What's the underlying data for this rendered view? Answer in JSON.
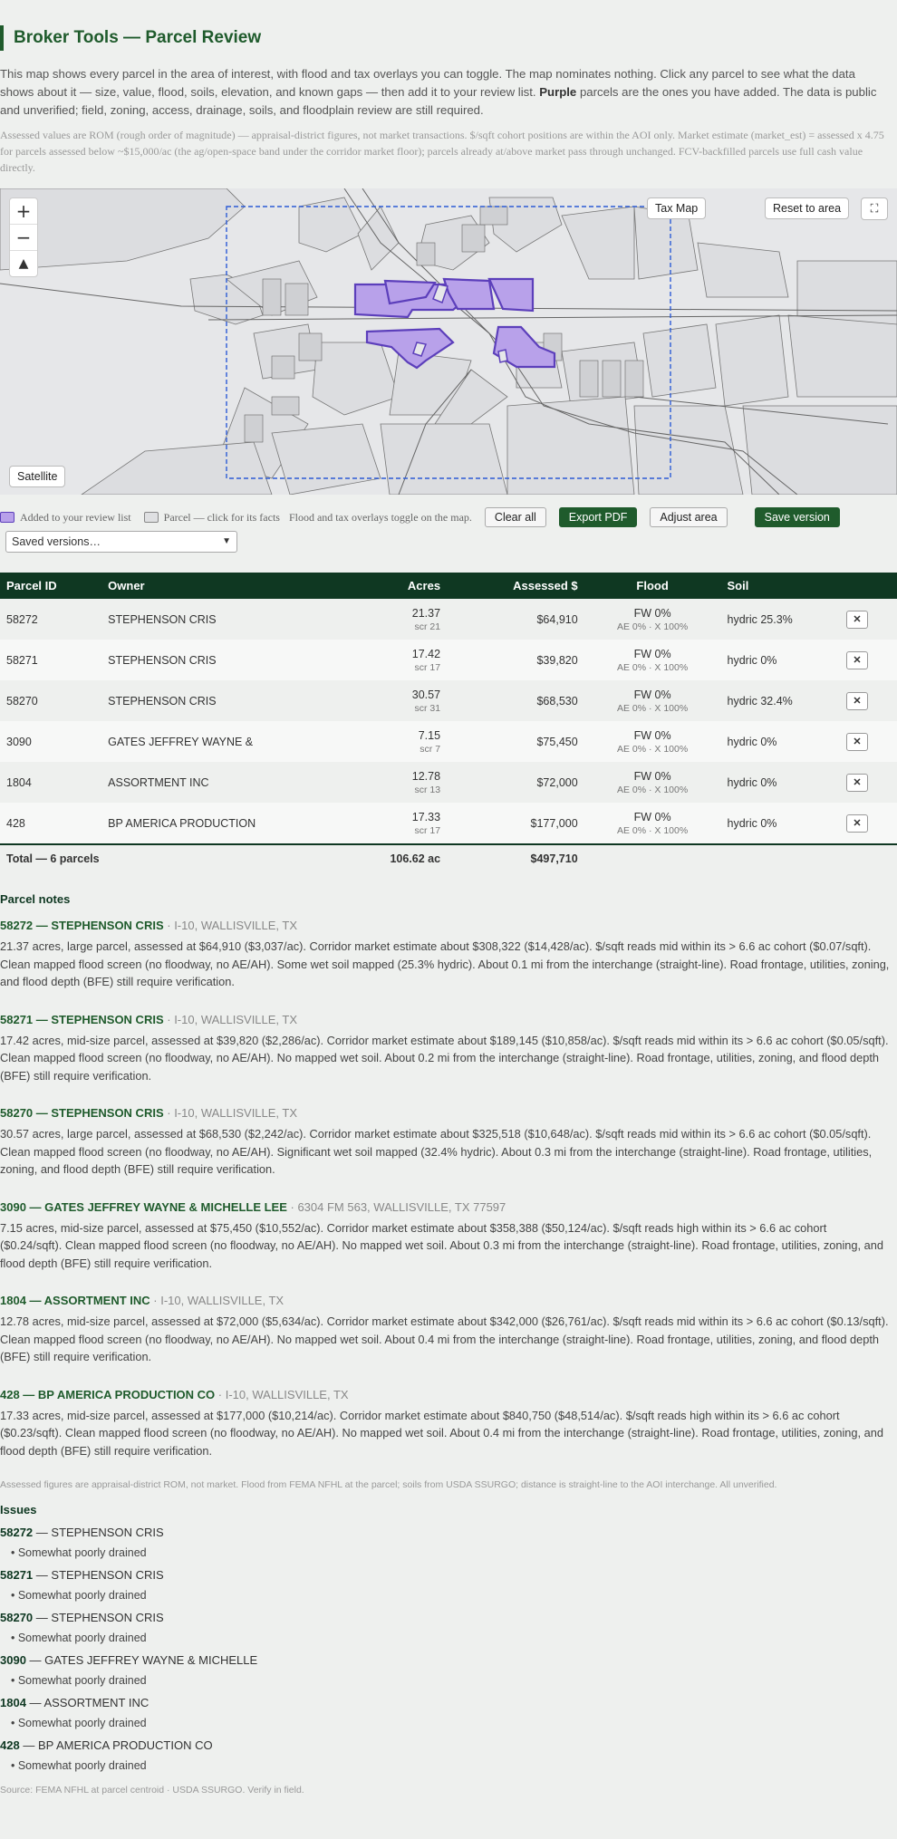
{
  "app": {
    "title": "Broker Tools — Parcel Review",
    "intro_main": "This map shows every parcel in the area of interest, with flood and tax overlays you can toggle. The map nominates nothing. Click any parcel to see what the data shows about it — size, value, flood, soils, elevation, and known gaps — then add it to your review list.",
    "intro_bold": "Purple",
    "intro_tail": "parcels are the ones you have added. The data is public and unverified; field, zoning, access, drainage, soils, and floodplain review are still required.",
    "fine_print": "Assessed values are ROM (rough order of magnitude) — appraisal-district figures, not market transactions. $/sqft cohort positions are within the AOI only. Market estimate (market_est) = assessed x 4.75 for parcels assessed below ~$15,000/ac (the ag/open-space band under the corridor market floor); parcels already at/above market pass through unchanged. FCV-backfilled parcels use full cash value directly."
  },
  "map": {
    "tax_map_label": "Tax Map",
    "reset_label": "Reset to area",
    "fullscreen_icon": "fullscreen-icon",
    "satellite_label": "Satellite",
    "zoom_in": "+",
    "zoom_out": "−",
    "north": "▲"
  },
  "legend": {
    "review_label": "Added to your review list",
    "parcel_label": "Parcel — click for its facts",
    "overlay_label": "Flood and tax overlays toggle on the map.",
    "colors": {
      "review": "#b8a1ea",
      "review_border": "#5c3fbb",
      "parcel": "#dfe0e2"
    }
  },
  "toolbar": {
    "clear_label": "Clear all",
    "export_label": "Export PDF",
    "adjust_label": "Adjust area",
    "save_label": "Save version",
    "versions_selected": "Saved versions…"
  },
  "table": {
    "headers": [
      "Parcel ID",
      "Owner",
      "Acres",
      "Assessed $",
      "Flood",
      "Soil",
      ""
    ],
    "rows": [
      {
        "id": "58272",
        "owner": "STEPHENSON CRIS",
        "acres": "21.37",
        "scr": "scr 21",
        "assessed": "$64,910",
        "flood": "FW 0%",
        "flood_sub": "AE 0% · X 100%",
        "soil": "hydric 25.3%"
      },
      {
        "id": "58271",
        "owner": "STEPHENSON CRIS",
        "acres": "17.42",
        "scr": "scr 17",
        "assessed": "$39,820",
        "flood": "FW 0%",
        "flood_sub": "AE 0% · X 100%",
        "soil": "hydric 0%"
      },
      {
        "id": "58270",
        "owner": "STEPHENSON CRIS",
        "acres": "30.57",
        "scr": "scr 31",
        "assessed": "$68,530",
        "flood": "FW 0%",
        "flood_sub": "AE 0% · X 100%",
        "soil": "hydric 32.4%"
      },
      {
        "id": "3090",
        "owner": "GATES JEFFREY WAYNE &",
        "acres": "7.15",
        "scr": "scr 7",
        "assessed": "$75,450",
        "flood": "FW 0%",
        "flood_sub": "AE 0% · X 100%",
        "soil": "hydric 0%"
      },
      {
        "id": "1804",
        "owner": "ASSORTMENT INC",
        "acres": "12.78",
        "scr": "scr 13",
        "assessed": "$72,000",
        "flood": "FW 0%",
        "flood_sub": "AE 0% · X 100%",
        "soil": "hydric 0%"
      },
      {
        "id": "428",
        "owner": "BP AMERICA PRODUCTION",
        "acres": "17.33",
        "scr": "scr 17",
        "assessed": "$177,000",
        "flood": "FW 0%",
        "flood_sub": "AE 0% · X 100%",
        "soil": "hydric 0%"
      }
    ],
    "remove_label": "✕",
    "total_label": "Total — 6 parcels",
    "total_acres": "106.62 ac",
    "total_assessed": "$497,710"
  },
  "notes": {
    "title": "Parcel notes",
    "items": [
      {
        "head": "58272 — STEPHENSON CRIS",
        "loc": "· I-10, WALLISVILLE, TX",
        "body": "21.37 acres, large parcel, assessed at $64,910 ($3,037/ac). Corridor market estimate about $308,322 ($14,428/ac). $/sqft reads mid within its > 6.6 ac cohort ($0.07/sqft). Clean mapped flood screen (no floodway, no AE/AH). Some wet soil mapped (25.3% hydric). About 0.1 mi from the interchange (straight-line). Road frontage, utilities, zoning, and flood depth (BFE) still require verification."
      },
      {
        "head": "58271 — STEPHENSON CRIS",
        "loc": "· I-10, WALLISVILLE, TX",
        "body": "17.42 acres, mid-size parcel, assessed at $39,820 ($2,286/ac). Corridor market estimate about $189,145 ($10,858/ac). $/sqft reads mid within its > 6.6 ac cohort ($0.05/sqft). Clean mapped flood screen (no floodway, no AE/AH). No mapped wet soil. About 0.2 mi from the interchange (straight-line). Road frontage, utilities, zoning, and flood depth (BFE) still require verification."
      },
      {
        "head": "58270 — STEPHENSON CRIS",
        "loc": "· I-10, WALLISVILLE, TX",
        "body": "30.57 acres, large parcel, assessed at $68,530 ($2,242/ac). Corridor market estimate about $325,518 ($10,648/ac). $/sqft reads mid within its > 6.6 ac cohort ($0.05/sqft). Clean mapped flood screen (no floodway, no AE/AH). Significant wet soil mapped (32.4% hydric). About 0.3 mi from the interchange (straight-line). Road frontage, utilities, zoning, and flood depth (BFE) still require verification."
      },
      {
        "head": "3090 — GATES JEFFREY WAYNE & MICHELLE LEE",
        "loc": "· 6304 FM 563, WALLISVILLE, TX 77597",
        "body": "7.15 acres, mid-size parcel, assessed at $75,450 ($10,552/ac). Corridor market estimate about $358,388 ($50,124/ac). $/sqft reads high within its > 6.6 ac cohort ($0.24/sqft). Clean mapped flood screen (no floodway, no AE/AH). No mapped wet soil. About 0.3 mi from the interchange (straight-line). Road frontage, utilities, zoning, and flood depth (BFE) still require verification."
      },
      {
        "head": "1804 — ASSORTMENT INC",
        "loc": "· I-10, WALLISVILLE, TX",
        "body": "12.78 acres, mid-size parcel, assessed at $72,000 ($5,634/ac). Corridor market estimate about $342,000 ($26,761/ac). $/sqft reads mid within its > 6.6 ac cohort ($0.13/sqft). Clean mapped flood screen (no floodway, no AE/AH). No mapped wet soil. About 0.4 mi from the interchange (straight-line). Road frontage, utilities, zoning, and flood depth (BFE) still require verification."
      },
      {
        "head": "428 — BP AMERICA PRODUCTION CO",
        "loc": "· I-10, WALLISVILLE, TX",
        "body": "17.33 acres, mid-size parcel, assessed at $177,000 ($10,214/ac). Corridor market estimate about $840,750 ($48,514/ac). $/sqft reads high within its > 6.6 ac cohort ($0.23/sqft). Clean mapped flood screen (no floodway, no AE/AH). No mapped wet soil. About 0.4 mi from the interchange (straight-line). Road frontage, utilities, zoning, and flood depth (BFE) still require verification."
      }
    ],
    "footnote": "Assessed figures are appraisal-district ROM, not market. Flood from FEMA NFHL at the parcel; soils from USDA SSURGO; distance is straight-line to the AOI interchange. All unverified."
  },
  "issues": {
    "title": "Issues",
    "items": [
      {
        "id": "58272",
        "name": "— STEPHENSON CRIS",
        "issue": "• Somewhat poorly drained"
      },
      {
        "id": "58271",
        "name": "— STEPHENSON CRIS",
        "issue": "• Somewhat poorly drained"
      },
      {
        "id": "58270",
        "name": "— STEPHENSON CRIS",
        "issue": "• Somewhat poorly drained"
      },
      {
        "id": "3090",
        "name": "— GATES JEFFREY WAYNE & MICHELLE",
        "issue": "• Somewhat poorly drained"
      },
      {
        "id": "1804",
        "name": "— ASSORTMENT INC",
        "issue": "• Somewhat poorly drained"
      },
      {
        "id": "428",
        "name": "— BP AMERICA PRODUCTION CO",
        "issue": "• Somewhat poorly drained"
      }
    ],
    "source": "Source: FEMA NFHL at parcel centroid · USDA SSURGO. Verify in field."
  }
}
